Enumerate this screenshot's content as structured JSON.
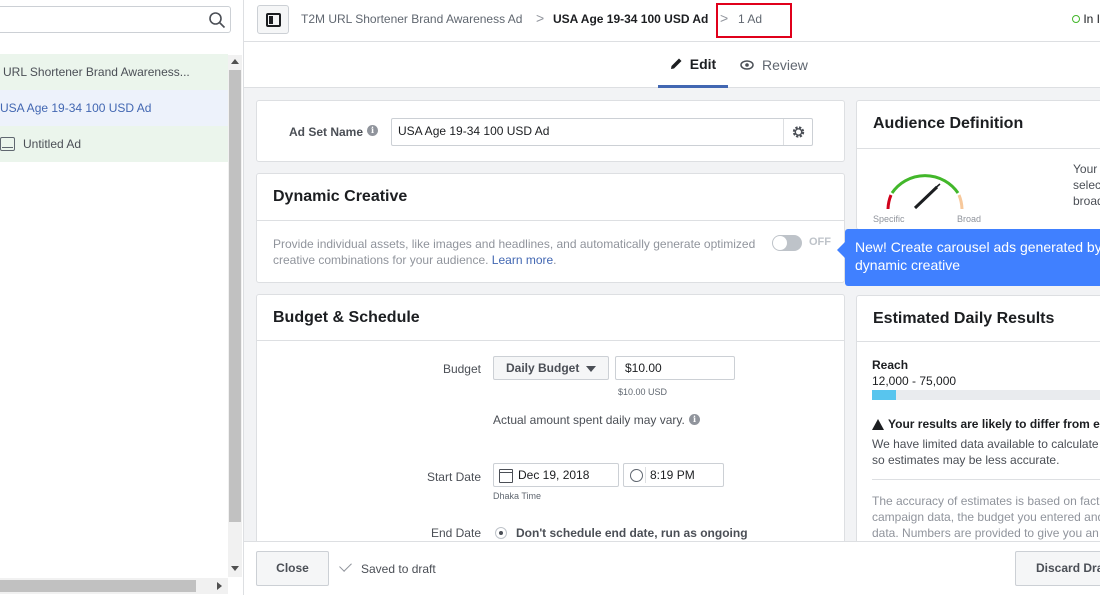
{
  "sidebar": {
    "search": {
      "placeholder": ""
    },
    "tree": {
      "campaign": "URL Shortener Brand Awareness...",
      "adset": "USA Age 19-34 100 USD Ad",
      "ad": "Untitled Ad"
    }
  },
  "header": {
    "breadcrumb": {
      "campaign": "T2M URL Shortener Brand Awareness Ad",
      "adset": "USA Age 19-34 100 USD Ad",
      "ad": "1 Ad",
      "separator": ">"
    },
    "status": "In I"
  },
  "tabs": {
    "edit": "Edit",
    "review": "Review"
  },
  "adset_name": {
    "label": "Ad Set Name",
    "value": "USA Age 19-34 100 USD Ad"
  },
  "dynamic_creative": {
    "title": "Dynamic Creative",
    "description": "Provide individual assets, like images and headlines, and automatically generate optimized creative combinations for your audience.",
    "learn_more": "Learn more",
    "period": ".",
    "toggle_label": "OFF"
  },
  "budget_schedule": {
    "title": "Budget & Schedule",
    "budget_label": "Budget",
    "budget_type": "Daily Budget",
    "budget_value": "$10.00",
    "budget_sub": "$10.00 USD",
    "actual_note": "Actual amount spent daily may vary.",
    "start_label": "Start Date",
    "start_date": "Dec 19, 2018",
    "start_time": "8:19 PM",
    "timezone": "Dhaka Time",
    "end_label": "End Date",
    "end_option": "Don't schedule end date, run as ongoing"
  },
  "audience": {
    "title": "Audience Definition",
    "gauge_specific": "Specific",
    "gauge_broad": "Broad",
    "text": "Your selec broad"
  },
  "tooltip": {
    "text": "New! Create carousel ads generated by dynamic creative"
  },
  "estimated": {
    "title": "Estimated Daily Results",
    "reach_label": "Reach",
    "reach_value": "12,000 - 75,000",
    "reach_fill": 0.1,
    "warn_title": "Your results are likely to differ from e",
    "warn_text": "We have limited data available to calculate so estimates may be less accurate.",
    "accuracy_text": "The accuracy of estimates is based on fact campaign data, the budget you entered and data. Numbers are provided to give you an"
  },
  "footer": {
    "close": "Close",
    "saved": "Saved to draft",
    "discard": "Discard Dra"
  },
  "colors": {
    "accent": "#4267b2",
    "tooltip": "#4080ff",
    "highlight": "#e0001b",
    "reach": "#58c5ee"
  }
}
